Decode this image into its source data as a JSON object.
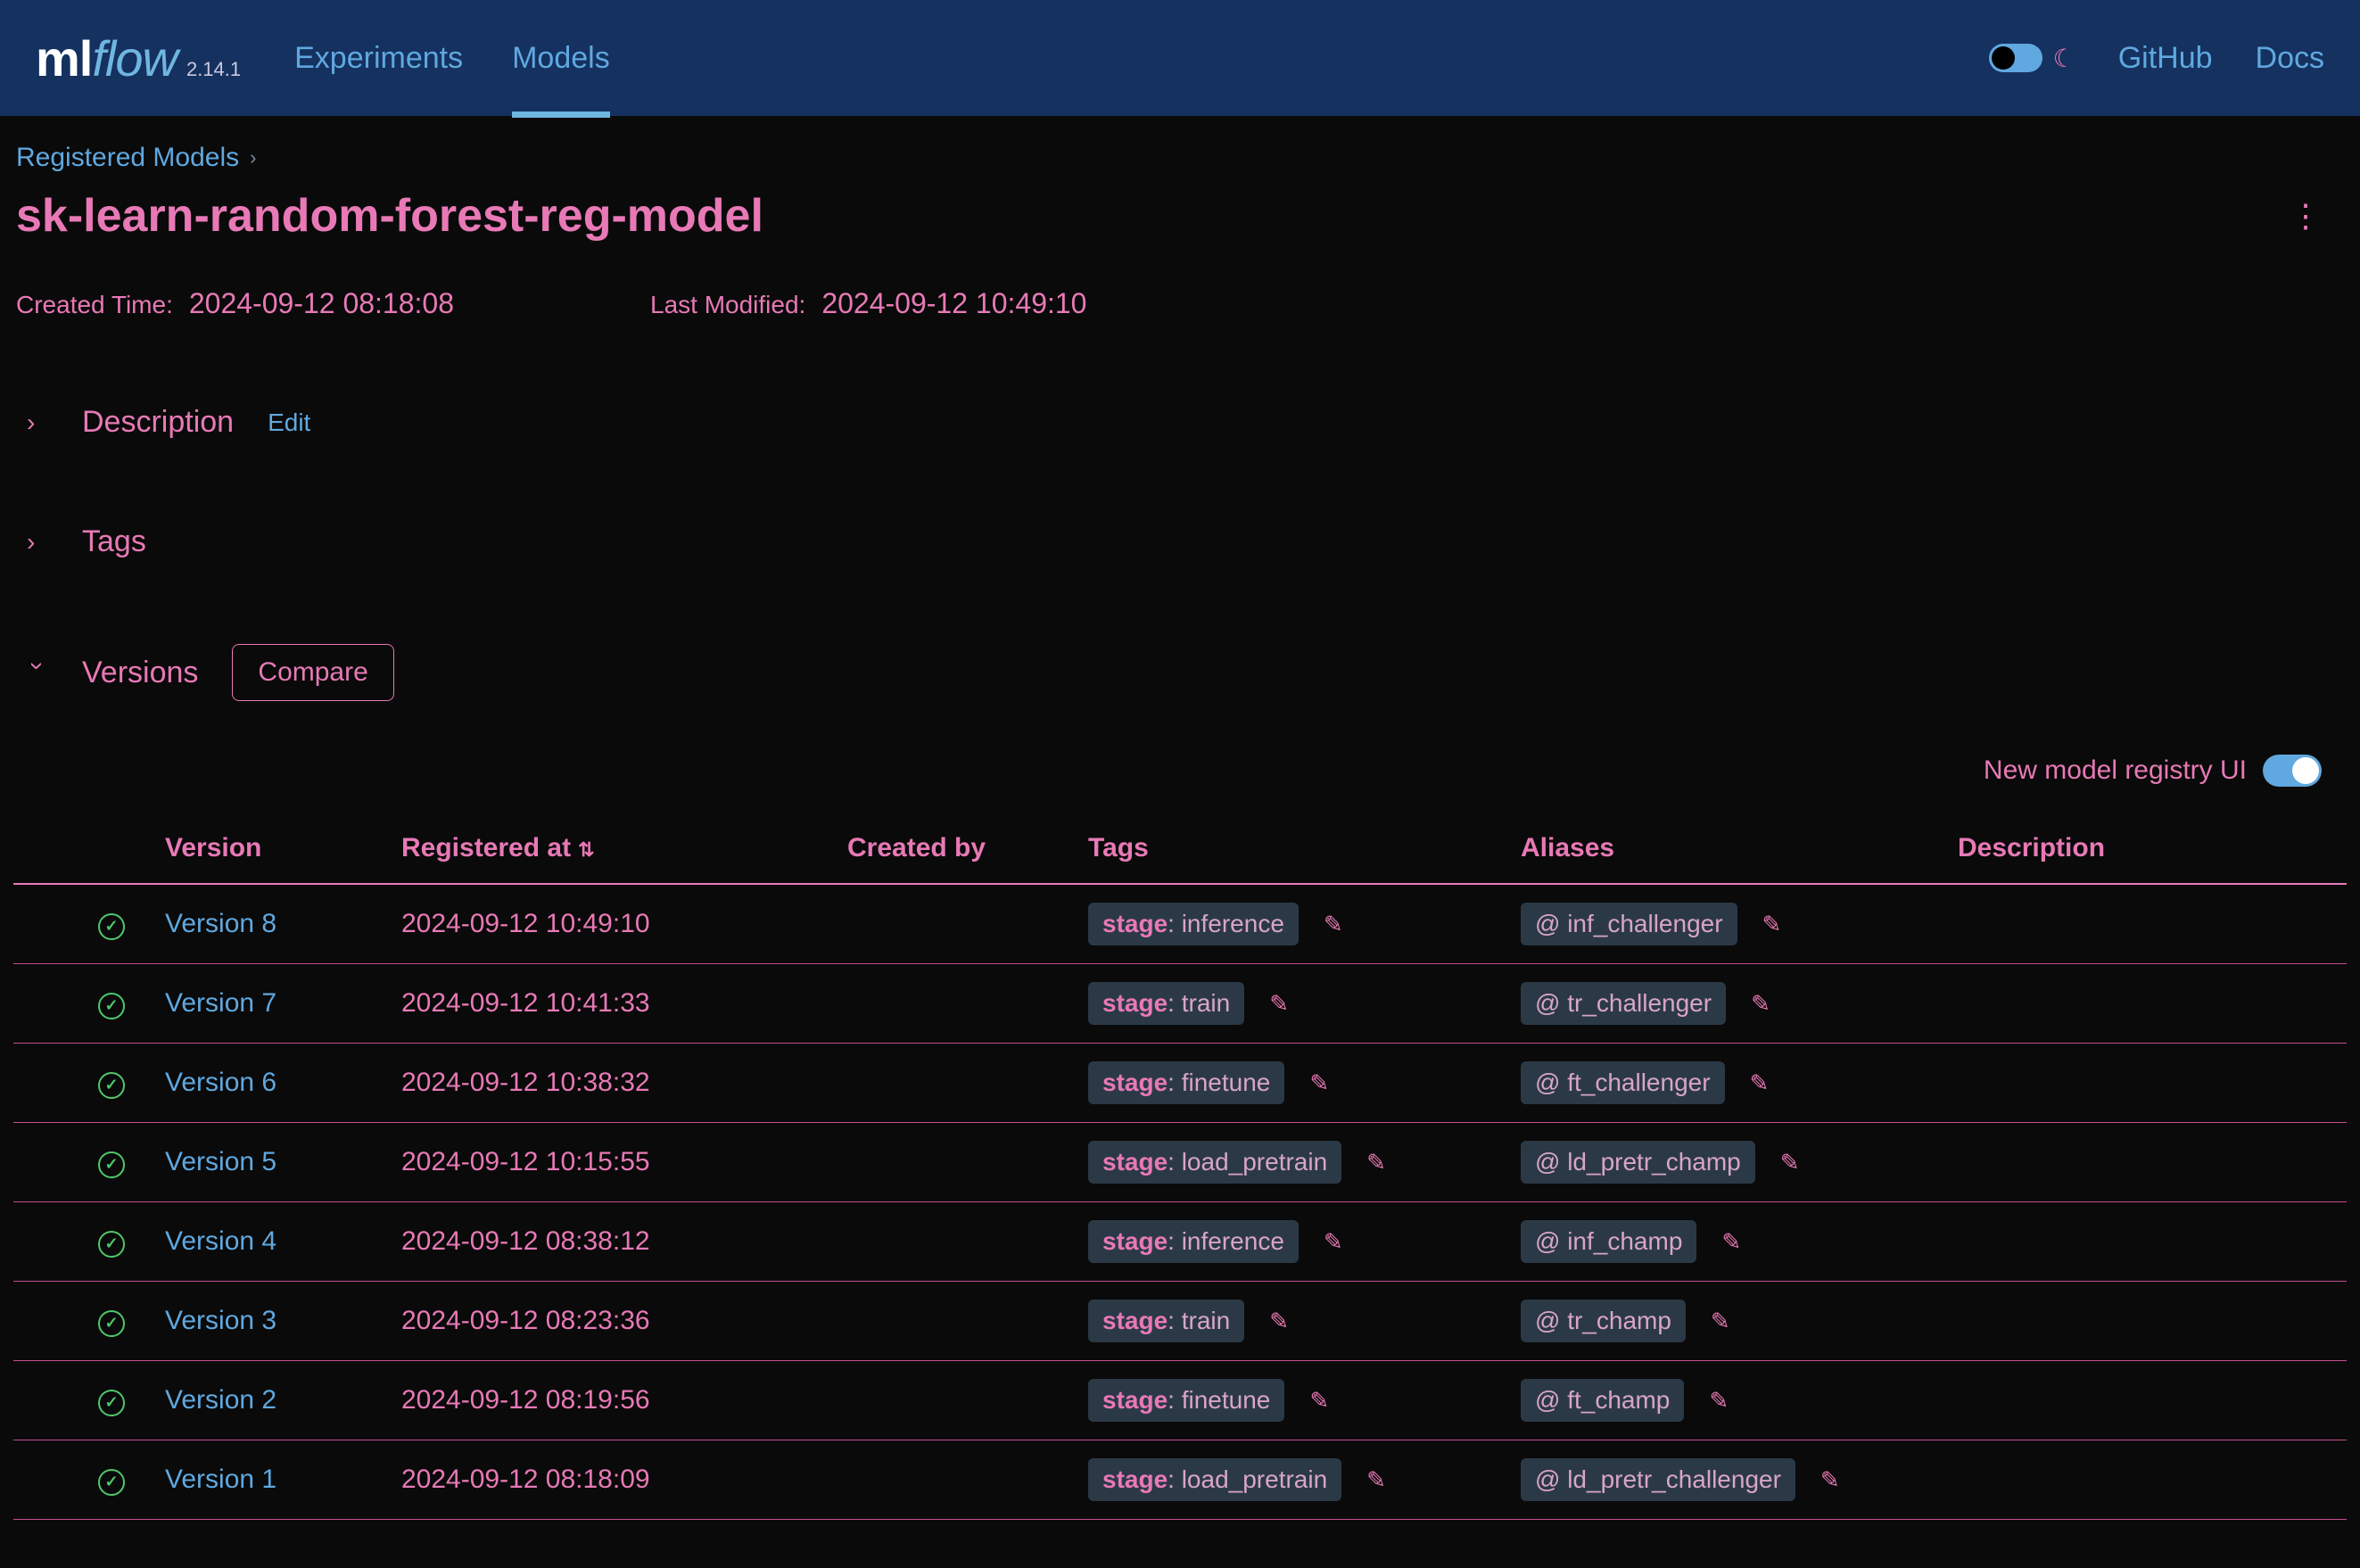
{
  "app": {
    "logo_ml": "ml",
    "logo_flow": "flow",
    "version": "2.14.1"
  },
  "nav": {
    "experiments": "Experiments",
    "models": "Models",
    "github": "GitHub",
    "docs": "Docs"
  },
  "breadcrumb": {
    "root": "Registered Models"
  },
  "page": {
    "title": "sk-learn-random-forest-reg-model",
    "created_label": "Created Time:",
    "created_value": "2024-09-12 08:18:08",
    "modified_label": "Last Modified:",
    "modified_value": "2024-09-12 10:49:10"
  },
  "sections": {
    "description": "Description",
    "edit": "Edit",
    "tags": "Tags",
    "versions": "Versions",
    "compare": "Compare"
  },
  "registry_toggle_label": "New model registry UI",
  "table": {
    "headers": {
      "version": "Version",
      "registered_at": "Registered at",
      "created_by": "Created by",
      "tags": "Tags",
      "aliases": "Aliases",
      "description": "Description"
    },
    "rows": [
      {
        "version": "Version 8",
        "registered_at": "2024-09-12 10:49:10",
        "tag_key": "stage",
        "tag_value": "inference",
        "alias": "inf_challenger"
      },
      {
        "version": "Version 7",
        "registered_at": "2024-09-12 10:41:33",
        "tag_key": "stage",
        "tag_value": "train",
        "alias": "tr_challenger"
      },
      {
        "version": "Version 6",
        "registered_at": "2024-09-12 10:38:32",
        "tag_key": "stage",
        "tag_value": "finetune",
        "alias": "ft_challenger"
      },
      {
        "version": "Version 5",
        "registered_at": "2024-09-12 10:15:55",
        "tag_key": "stage",
        "tag_value": "load_pretrain",
        "alias": "ld_pretr_champ"
      },
      {
        "version": "Version 4",
        "registered_at": "2024-09-12 08:38:12",
        "tag_key": "stage",
        "tag_value": "inference",
        "alias": "inf_champ"
      },
      {
        "version": "Version 3",
        "registered_at": "2024-09-12 08:23:36",
        "tag_key": "stage",
        "tag_value": "train",
        "alias": "tr_champ"
      },
      {
        "version": "Version 2",
        "registered_at": "2024-09-12 08:19:56",
        "tag_key": "stage",
        "tag_value": "finetune",
        "alias": "ft_champ"
      },
      {
        "version": "Version 1",
        "registered_at": "2024-09-12 08:18:09",
        "tag_key": "stage",
        "tag_value": "load_pretrain",
        "alias": "ld_pretr_challenger"
      }
    ]
  }
}
